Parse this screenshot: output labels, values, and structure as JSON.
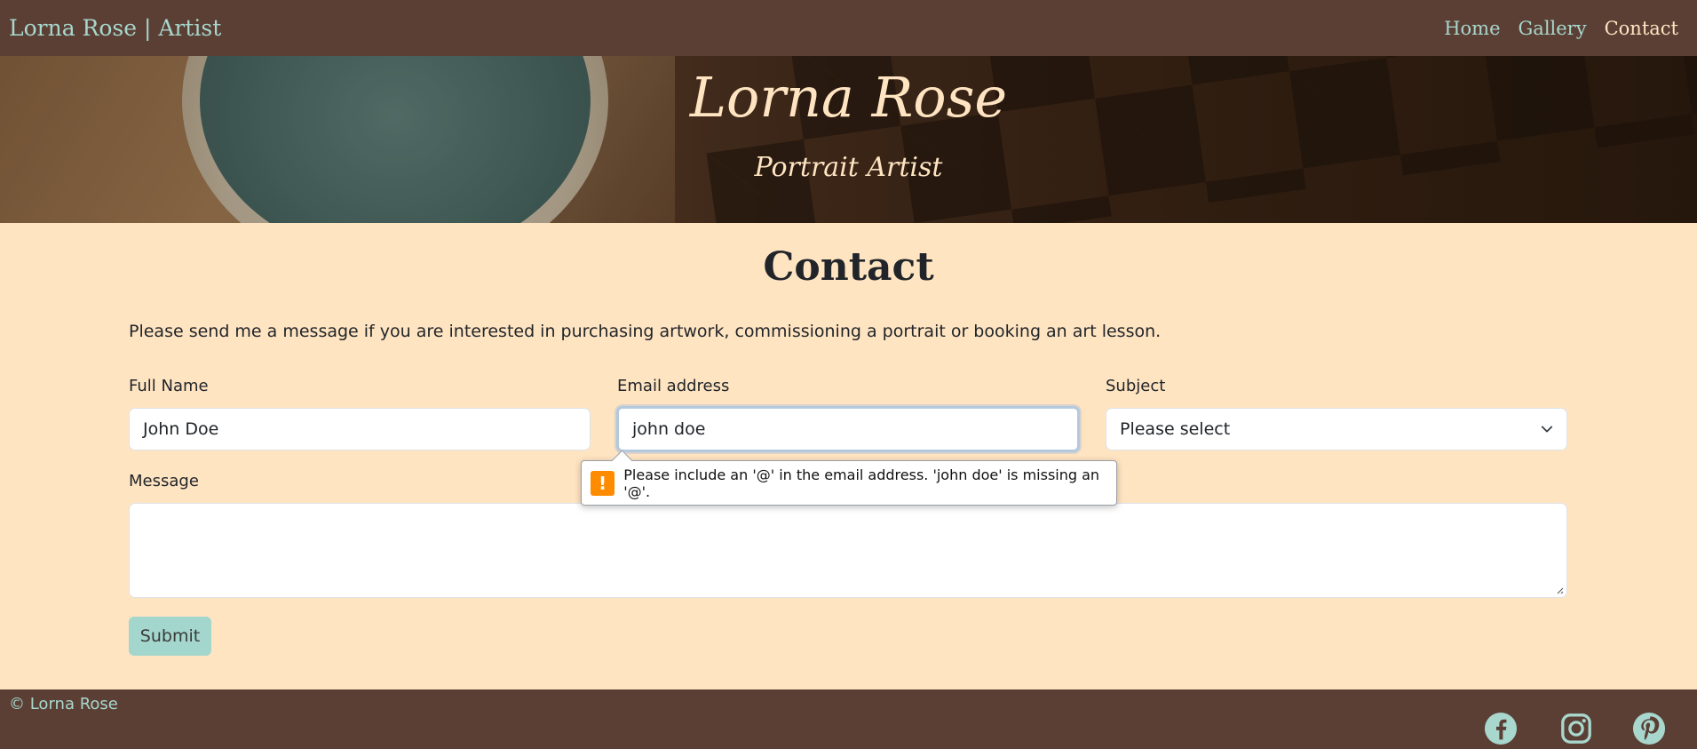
{
  "nav": {
    "brand": "Lorna Rose | Artist",
    "links": [
      {
        "label": "Home",
        "active": false
      },
      {
        "label": "Gallery",
        "active": false
      },
      {
        "label": "Contact",
        "active": true
      }
    ]
  },
  "hero": {
    "title": "Lorna Rose",
    "subtitle": "Portrait Artist"
  },
  "page": {
    "title": "Contact",
    "intro": "Please send me a message if you are interested in purchasing artwork, commissioning a portrait or booking an art lesson."
  },
  "form": {
    "full_name": {
      "label": "Full Name",
      "value": "John Doe"
    },
    "email": {
      "label": "Email address",
      "value": "john doe"
    },
    "subject": {
      "label": "Subject",
      "selected": "Please select"
    },
    "message": {
      "label": "Message",
      "value": ""
    },
    "submit_label": "Submit"
  },
  "validation": {
    "message": "Please include an '@' in the email address. 'john doe' is missing an '@'.",
    "icon": "warning-icon",
    "color": "#ff8c00"
  },
  "footer": {
    "copyright": "© Lorna Rose",
    "social": [
      "facebook-icon",
      "instagram-icon",
      "pinterest-icon"
    ]
  },
  "colors": {
    "nav_bg": "#5b3f35",
    "page_bg": "#ffe4c2",
    "accent": "#a8d7cd",
    "button": "#a3d6cc"
  }
}
